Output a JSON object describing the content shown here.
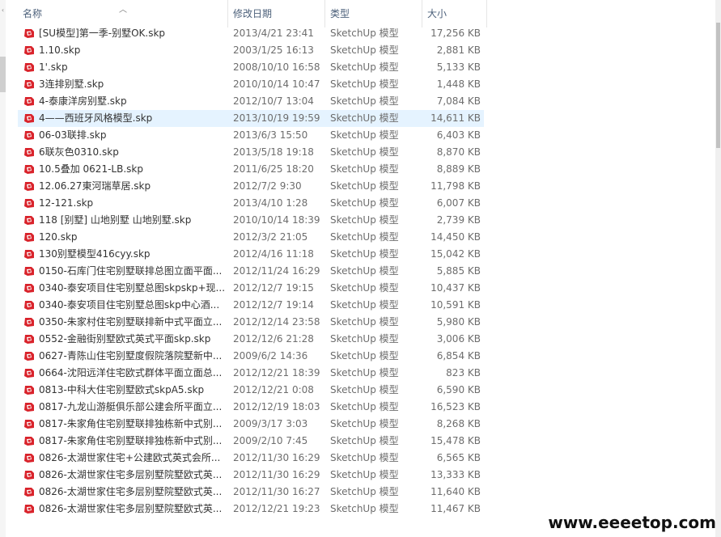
{
  "columns": {
    "name": "名称",
    "date": "修改日期",
    "type": "类型",
    "size": "大小"
  },
  "sort_icon": "chevron-up-icon",
  "file_icon": "sketchup-file-icon",
  "accent_color": "#e5f3ff",
  "icon_color": "#d9232b",
  "files": [
    {
      "name": "[SU模型]第一季-别墅OK.skp",
      "date": "2013/4/21 23:41",
      "type": "SketchUp 模型",
      "size": "17,256 KB"
    },
    {
      "name": "1.10.skp",
      "date": "2003/1/25 16:13",
      "type": "SketchUp 模型",
      "size": "2,881 KB"
    },
    {
      "name": "1'.skp",
      "date": "2008/10/10 16:58",
      "type": "SketchUp 模型",
      "size": "5,133 KB"
    },
    {
      "name": "3连排别墅.skp",
      "date": "2010/10/14 10:47",
      "type": "SketchUp 模型",
      "size": "1,448 KB"
    },
    {
      "name": "4-泰康洋房别墅.skp",
      "date": "2012/10/7 13:04",
      "type": "SketchUp 模型",
      "size": "7,084 KB"
    },
    {
      "name": "4——西班牙风格模型.skp",
      "date": "2013/10/19 19:59",
      "type": "SketchUp 模型",
      "size": "14,611 KB",
      "selected": true
    },
    {
      "name": "06-03联排.skp",
      "date": "2013/6/3 15:50",
      "type": "SketchUp 模型",
      "size": "6,403 KB"
    },
    {
      "name": "6联灰色0310.skp",
      "date": "2013/5/18 19:18",
      "type": "SketchUp 模型",
      "size": "8,870 KB"
    },
    {
      "name": "10.5叠加 0621-LB.skp",
      "date": "2011/6/25 18:20",
      "type": "SketchUp 模型",
      "size": "8,889 KB"
    },
    {
      "name": "12.06.27東河瑞草居.skp",
      "date": "2012/7/2 9:30",
      "type": "SketchUp 模型",
      "size": "11,798 KB"
    },
    {
      "name": "12-121.skp",
      "date": "2013/4/10 1:28",
      "type": "SketchUp 模型",
      "size": "6,007 KB"
    },
    {
      "name": "118 [别墅] 山地别墅 山地别墅.skp",
      "date": "2010/10/14 18:39",
      "type": "SketchUp 模型",
      "size": "2,739 KB"
    },
    {
      "name": "120.skp",
      "date": "2012/3/2 21:05",
      "type": "SketchUp 模型",
      "size": "14,450 KB"
    },
    {
      "name": "130别墅模型416cyy.skp",
      "date": "2012/4/16 11:18",
      "type": "SketchUp 模型",
      "size": "15,042 KB"
    },
    {
      "name": "0150-石库门住宅别墅联排总图立面平面...",
      "date": "2012/11/24 16:29",
      "type": "SketchUp 模型",
      "size": "5,885 KB"
    },
    {
      "name": "0340-泰安项目住宅别墅总图skpskp+现...",
      "date": "2012/12/7 19:15",
      "type": "SketchUp 模型",
      "size": "10,437 KB"
    },
    {
      "name": "0340-泰安项目住宅别墅总图skp中心酒...",
      "date": "2012/12/7 19:14",
      "type": "SketchUp 模型",
      "size": "10,591 KB"
    },
    {
      "name": "0350-朱家村住宅别墅联排新中式平面立...",
      "date": "2012/12/14 23:58",
      "type": "SketchUp 模型",
      "size": "5,980 KB"
    },
    {
      "name": "0552-金融街别墅欧式英式平面skp.skp",
      "date": "2012/12/6 21:28",
      "type": "SketchUp 模型",
      "size": "3,006 KB"
    },
    {
      "name": "0627-青陈山住宅别墅度假院落院墅新中...",
      "date": "2009/6/2 14:36",
      "type": "SketchUp 模型",
      "size": "6,854 KB"
    },
    {
      "name": "0664-沈阳远洋住宅欧式群体平面立面总...",
      "date": "2012/12/21 18:39",
      "type": "SketchUp 模型",
      "size": "823 KB"
    },
    {
      "name": "0813-中科大住宅别墅欧式skpA5.skp",
      "date": "2012/12/21 0:08",
      "type": "SketchUp 模型",
      "size": "6,590 KB"
    },
    {
      "name": "0817-九龙山游艇俱乐部公建会所平面立...",
      "date": "2012/12/19 18:03",
      "type": "SketchUp 模型",
      "size": "16,523 KB"
    },
    {
      "name": "0817-朱家角住宅别墅联排独栋新中式别...",
      "date": "2009/3/17 3:03",
      "type": "SketchUp 模型",
      "size": "8,268 KB"
    },
    {
      "name": "0817-朱家角住宅别墅联排独栋新中式别...",
      "date": "2009/2/10 7:45",
      "type": "SketchUp 模型",
      "size": "15,478 KB"
    },
    {
      "name": "0826-太湖世家住宅+公建欧式英式会所...",
      "date": "2012/11/30 16:29",
      "type": "SketchUp 模型",
      "size": "6,565 KB"
    },
    {
      "name": "0826-太湖世家住宅多层别墅院墅欧式英...",
      "date": "2012/11/30 16:29",
      "type": "SketchUp 模型",
      "size": "13,333 KB"
    },
    {
      "name": "0826-太湖世家住宅多层别墅院墅欧式英...",
      "date": "2012/11/30 16:27",
      "type": "SketchUp 模型",
      "size": "11,640 KB"
    },
    {
      "name": "0826-太湖世家住宅多层别墅院墅欧式英...",
      "date": "2012/12/21 19:23",
      "type": "SketchUp 模型",
      "size": "11,467 KB"
    }
  ],
  "watermark": "www.eeeetop.com"
}
